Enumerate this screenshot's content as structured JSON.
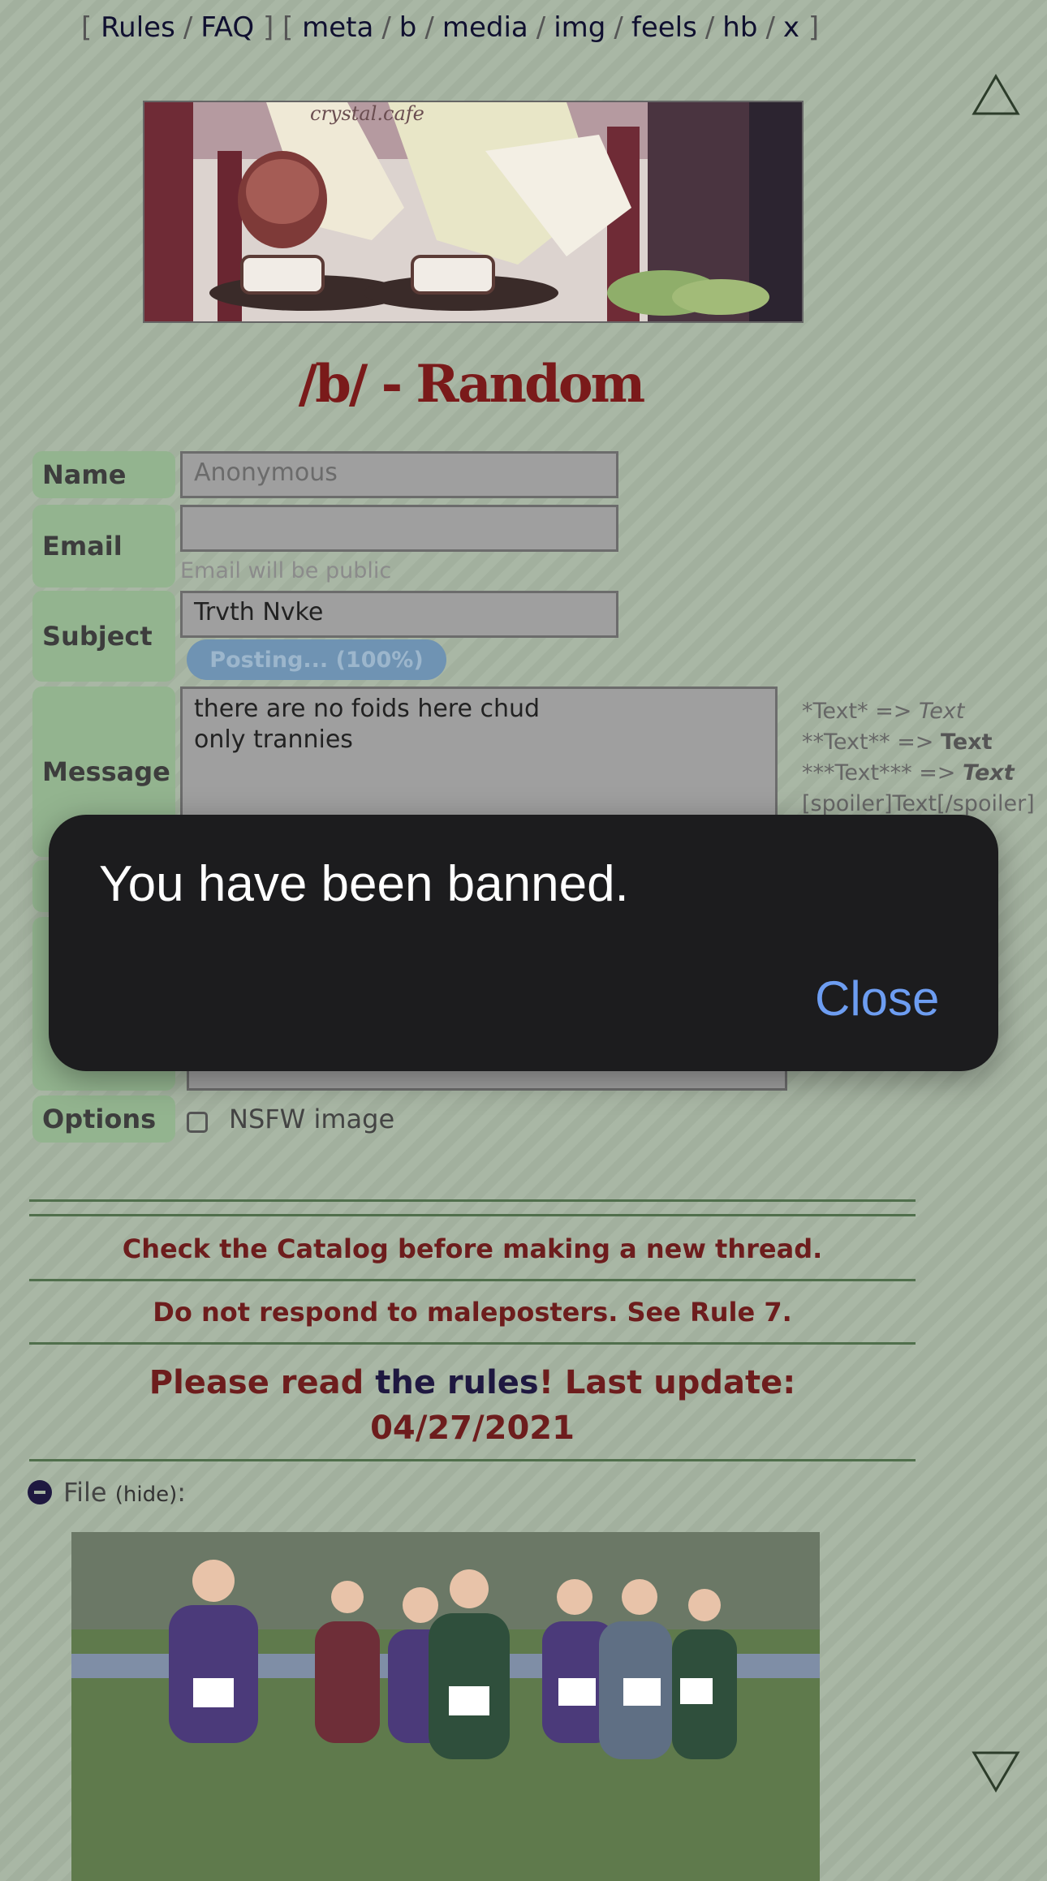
{
  "nav": {
    "group1": [
      "Rules",
      "FAQ"
    ],
    "group2": [
      "meta",
      "b",
      "media",
      "img",
      "feels",
      "hb",
      "x"
    ]
  },
  "banner": {
    "watermark": "crystal.cafe"
  },
  "board": {
    "title": "/b/ - Random"
  },
  "form": {
    "name_label": "Name",
    "name_placeholder": "Anonymous",
    "email_label": "Email",
    "email_hint": "Email will be public",
    "subject_label": "Subject",
    "subject_value": "Trvth Nvke",
    "posting_status": "Posting... (100%)",
    "message_label": "Message",
    "message_line1": "there are no foids here chud",
    "message_line2": "only trannies",
    "options_label": "Options",
    "nsfw_label": "NSFW image"
  },
  "formatting": {
    "italic_src": "*Text* =>",
    "italic_out": "Text",
    "bold_src": "**Text** =>",
    "bold_out": "Text",
    "bolditalic_src": "***Text*** =>",
    "bolditalic_out": "Text",
    "spoiler": "[spoiler]Text[/spoiler]"
  },
  "notices": {
    "catalog": "Check the Catalog before making a new thread.",
    "maleposters": "Do not respond to maleposters. See Rule 7.",
    "rules_pre": "Please read",
    "rules_link": "the rules",
    "rules_post": "! Last update:",
    "rules_date": "04/27/2021"
  },
  "file": {
    "label": "File",
    "hide": "hide"
  },
  "modal": {
    "title": "You have been banned.",
    "close": "Close"
  },
  "colors": {
    "title_red": "#7a1a1a",
    "label_green": "#93b48f",
    "modal_bg": "#1c1c1e",
    "close_blue": "#6d9df1"
  }
}
